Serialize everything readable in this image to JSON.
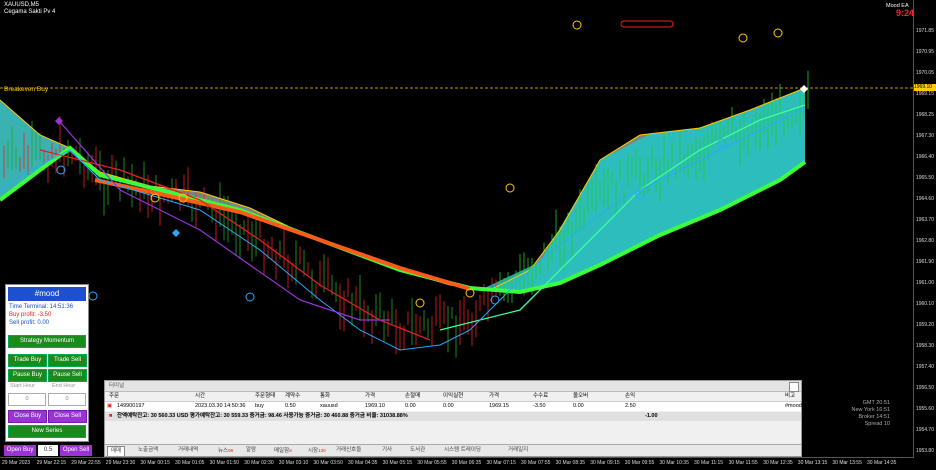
{
  "header": {
    "symbol": "XAUUSD,M5",
    "indicator": "Cegama Sakti Pv 4",
    "breakeven": "Breakeven Buy",
    "right_label": "Mood EA",
    "signal": "9:24"
  },
  "price_axis": [
    "1971.85",
    "1970.95",
    "1970.05",
    "1969.15",
    "1968.25",
    "1967.30",
    "1966.40",
    "1965.50",
    "1964.60",
    "1963.70",
    "1962.80",
    "1961.90",
    "1961.00",
    "1960.10",
    "1959.20",
    "1958.30",
    "1957.40",
    "1956.50",
    "1955.60",
    "1954.70",
    "1953.80"
  ],
  "price_current": "1969.10",
  "time_axis": [
    "29 Mar 2023",
    "29 Mar 22:15",
    "29 Mar 22:55",
    "29 Mar 23:30",
    "30 Mar 00:15",
    "30 Mar 01:05",
    "30 Mar 01:50",
    "30 Mar 02:30",
    "30 Mar 03:10",
    "30 Mar 03:50",
    "30 Mar 04:35",
    "30 Mar 05:15",
    "30 Mar 05:55",
    "30 Mar 06:35",
    "30 Mar 07:15",
    "30 Mar 07:55",
    "30 Mar 08:35",
    "30 Mar 09:15",
    "30 Mar 09:55",
    "30 Mar 10:35",
    "30 Mar 11:15",
    "30 Mar 11:55",
    "30 Mar 12:35",
    "30 Mar 13:15",
    "30 Mar 13:55",
    "30 Mar 14:35"
  ],
  "mood": {
    "title": "#mood",
    "time": "Time Terminal: 14:51:36",
    "buy_profit": "Buy profit: -3.50",
    "sell_profit": "Sell profit: 0.00",
    "strategy": "Strategy Momentum",
    "trade_buy": "Trade Buy",
    "trade_sell": "Trade Sell",
    "pause_buy": "Pause Buy",
    "pause_sell": "Pause Sell",
    "start_hour": "Start Hour",
    "end_hour": "End Hour",
    "start_val": "0",
    "end_val": "0",
    "close_buy": "Close Buy",
    "close_sell": "Close Sell",
    "new_series": "New Series",
    "open_buy": "Open Buy",
    "lot": "0.5",
    "open_sell": "Open Sell"
  },
  "terminal": {
    "title": "터미널",
    "headers": [
      "주문",
      "시간",
      "주문형태",
      "계약수",
      "통화",
      "가격",
      "손절매",
      "이익실현",
      "가격",
      "수수료",
      "올오버",
      "손익",
      "비고"
    ],
    "order": [
      "149900197",
      "2023.03.30 14:50:36",
      "buy",
      "0.50",
      "xauusd",
      "1969.10",
      "0.00",
      "0.00",
      "1969.15",
      "-3.50",
      "0.00",
      "2.50",
      "#mood"
    ],
    "summary": "잔액예탁잔고: 30 560.33 USD  평가예탁잔고: 30 559.33  증거금: 98.46  사용가능 증거금: 30 460.88  증거금 비율: 31038.88%",
    "summary_pl": "-1.00",
    "tabs": [
      "매매",
      "노출금액",
      "거래내역",
      "뉴스",
      "알람",
      "메일함",
      "시장",
      "거래신호들",
      "기사",
      "도서관",
      "시스템 트레이딩",
      "거래일지"
    ],
    "tab_badges": {
      "뉴스": "99",
      "메일함": "8",
      "시장": "130"
    }
  },
  "info": [
    [
      "GMT",
      "20:51"
    ],
    [
      "New York",
      "16:51"
    ],
    [
      "Broker",
      "14:51"
    ],
    [
      "Spread",
      "10"
    ]
  ],
  "colors": {
    "teal": "#1ec8c8",
    "green": "#3cff3c",
    "orange": "#ff5a1a",
    "gray": "#9a9a9a",
    "red": "#e02020"
  }
}
